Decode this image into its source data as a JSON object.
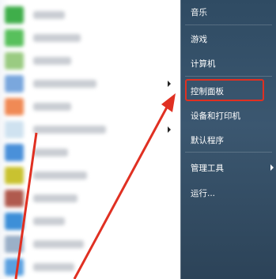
{
  "start_menu": {
    "program_list": {
      "items": [
        {
          "icon": "blurred-program-icon",
          "icon_color": "#3fae4a",
          "has_submenu": false
        },
        {
          "icon": "blurred-program-icon",
          "icon_color": "#58c05c",
          "has_submenu": false
        },
        {
          "icon": "blurred-program-icon",
          "icon_color": "#9acb82",
          "has_submenu": false
        },
        {
          "icon": "blurred-program-icon",
          "icon_color": "#7aa7dd",
          "has_submenu": true
        },
        {
          "icon": "blurred-program-icon",
          "icon_color": "#f08a55",
          "has_submenu": false
        },
        {
          "icon": "blurred-program-icon",
          "icon_color": "#cfe2f0",
          "has_submenu": true
        },
        {
          "icon": "blurred-program-icon",
          "icon_color": "#4a90d9",
          "has_submenu": false
        },
        {
          "icon": "blurred-program-icon",
          "icon_color": "#c9c230",
          "has_submenu": false
        },
        {
          "icon": "blurred-program-icon",
          "icon_color": "#b05a4e",
          "has_submenu": false
        },
        {
          "icon": "blurred-program-icon",
          "icon_color": "#3d8fd8",
          "has_submenu": false
        },
        {
          "icon": "blurred-program-icon",
          "icon_color": "#9bb0c8",
          "has_submenu": false
        },
        {
          "icon": "blurred-program-icon",
          "icon_color": "#5aa0e0",
          "has_submenu": false
        }
      ]
    },
    "right_menu": {
      "items": [
        {
          "label": "音乐",
          "has_submenu": false
        },
        {
          "label": "游戏",
          "has_submenu": false
        },
        {
          "label": "计算机",
          "has_submenu": false
        },
        {
          "label": "控制面板",
          "has_submenu": false,
          "highlighted": true
        },
        {
          "label": "设备和打印机",
          "has_submenu": false
        },
        {
          "label": "默认程序",
          "has_submenu": false
        },
        {
          "label": "管理工具",
          "has_submenu": true
        },
        {
          "label": "运行...",
          "has_submenu": false
        }
      ]
    }
  },
  "annotation": {
    "highlight_color": "#e03022",
    "arrow_color": "#e03022"
  }
}
